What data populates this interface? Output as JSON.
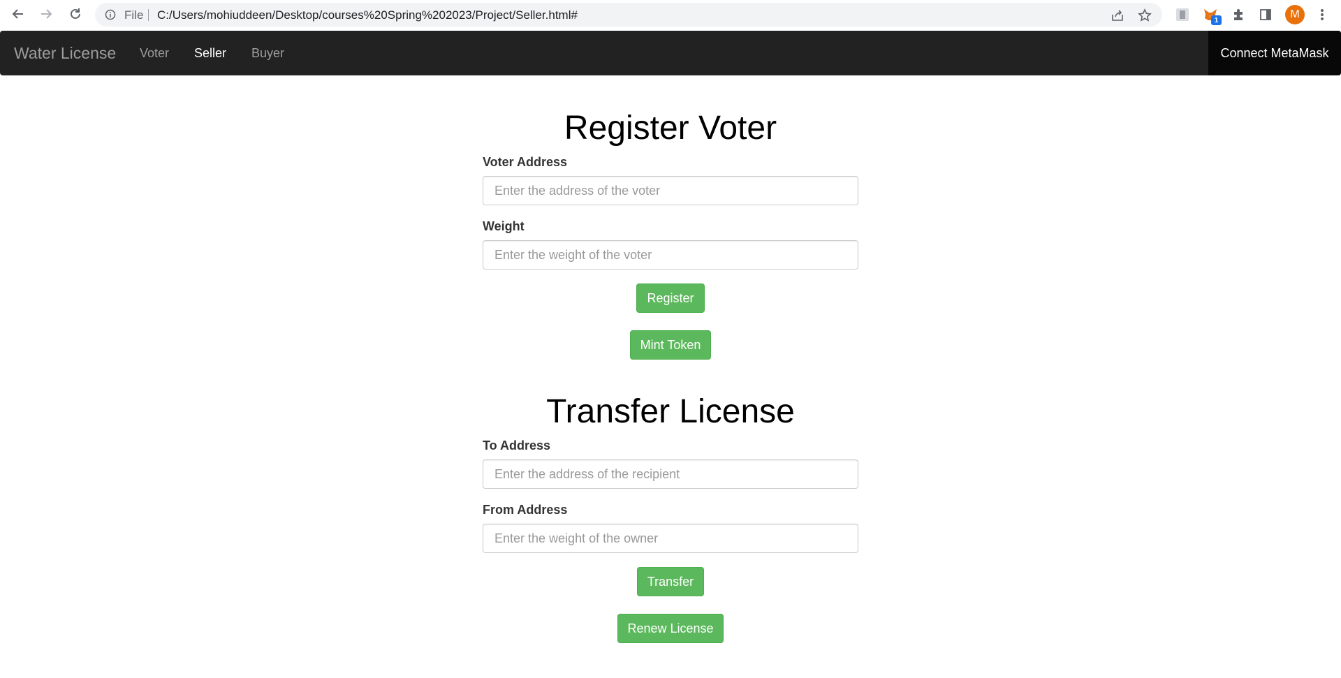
{
  "browser": {
    "file_label": "File",
    "url": "C:/Users/mohiuddeen/Desktop/courses%20Spring%202023/Project/Seller.html#",
    "extension_badge": "1",
    "profile_initial": "M"
  },
  "navbar": {
    "brand": "Water License",
    "links": [
      {
        "label": "Voter",
        "active": false
      },
      {
        "label": "Seller",
        "active": true
      },
      {
        "label": "Buyer",
        "active": false
      }
    ],
    "connect_label": "Connect MetaMask"
  },
  "register": {
    "title": "Register Voter",
    "voter_address_label": "Voter Address",
    "voter_address_placeholder": "Enter the address of the voter",
    "weight_label": "Weight",
    "weight_placeholder": "Enter the weight of the voter",
    "register_button": "Register",
    "mint_button": "Mint Token"
  },
  "transfer": {
    "title": "Transfer License",
    "to_label": "To Address",
    "to_placeholder": "Enter the address of the recipient",
    "from_label": "From Address",
    "from_placeholder": "Enter the weight of the owner",
    "transfer_button": "Transfer",
    "renew_button": "Renew License"
  },
  "colors": {
    "navbar_bg": "#222222",
    "button_green": "#5cb85c",
    "avatar_orange": "#e8710a"
  }
}
